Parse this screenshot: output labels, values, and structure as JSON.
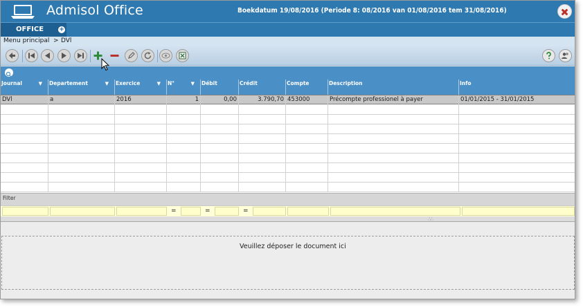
{
  "app": {
    "title": "Admisol Office",
    "period_info": "Boekdatum 19/08/2016 (Periode 8: 08/2016 van 01/08/2016 tem 31/08/2016)"
  },
  "tabs": [
    {
      "label": "OFFICE",
      "add_symbol": "+"
    }
  ],
  "breadcrumb": {
    "root": "Menu principal",
    "separator": ">",
    "current": "DVl"
  },
  "toolbar": {
    "buttons": [
      "back-icon",
      "first-record-icon",
      "previous-record-icon",
      "next-record-icon",
      "last-record-icon",
      "add-icon",
      "delete-icon",
      "edit-icon",
      "refresh-icon",
      "preview-icon",
      "excel-export-icon"
    ],
    "right_buttons": [
      "help-icon",
      "users-icon"
    ]
  },
  "grid": {
    "columns": [
      {
        "label": "Journal",
        "sortable": true
      },
      {
        "label": "Departement",
        "sortable": true
      },
      {
        "label": "Exercice",
        "sortable": true
      },
      {
        "label": "N°",
        "sortable": true
      },
      {
        "label": "Débit",
        "sortable": false
      },
      {
        "label": "Crédit",
        "sortable": false
      },
      {
        "label": "Compte",
        "sortable": false
      },
      {
        "label": "Description",
        "sortable": false
      },
      {
        "label": "Info",
        "sortable": false
      }
    ],
    "rows": [
      [
        "DVl",
        "a",
        "2016",
        "1",
        "0,00",
        "3.790,70",
        "453000",
        "Précompte professionel à payer",
        "01/01/2015 - 31/01/2015"
      ]
    ],
    "sort_arrow": "▼"
  },
  "filter": {
    "label": "Filter",
    "operators": [
      "=",
      "=",
      "="
    ]
  },
  "dropzone": {
    "text": "Veuillez déposer le document ici"
  },
  "colors": {
    "titlebar": "#2e79b0",
    "tab_active": "#1e5f92",
    "grid_header": "#4a8fc6",
    "add_green": "#2e8b3a",
    "delete_red": "#b8312f",
    "close_red": "#c0302b",
    "filter_bg": "#ffffcc"
  }
}
